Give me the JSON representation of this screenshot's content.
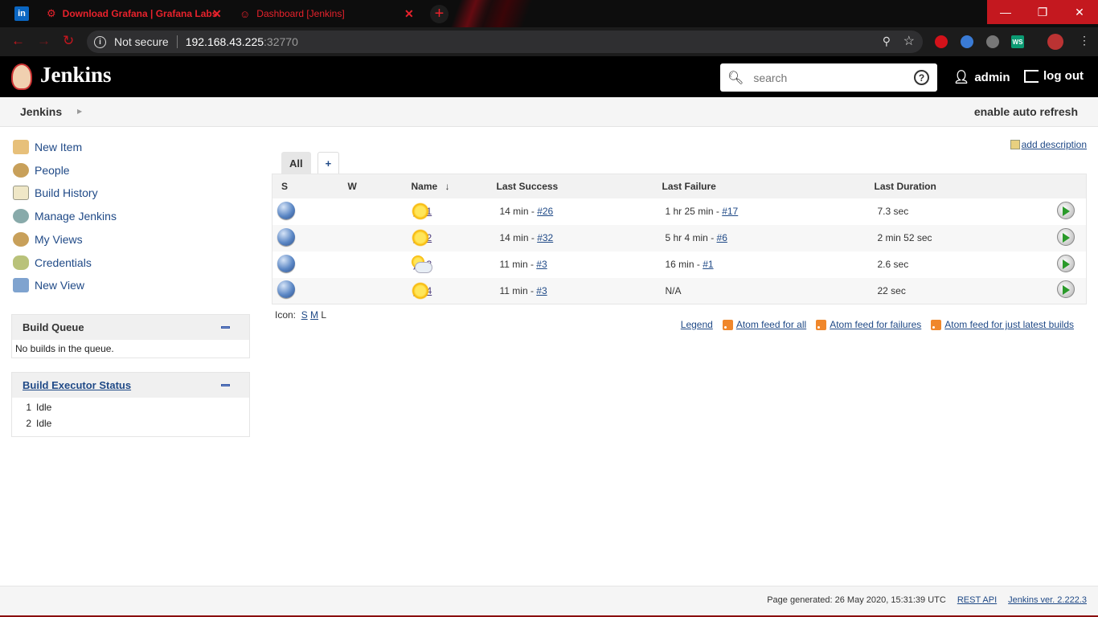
{
  "browser": {
    "tabs": [
      {
        "title": "Download Grafana | Grafana Labs",
        "active": false
      },
      {
        "title": "Dashboard [Jenkins]",
        "active": true
      }
    ],
    "security_label": "Not secure",
    "url_host": "192.168.43.225",
    "url_port": ":32770",
    "window_controls": {
      "minimize": "—",
      "restore": "❐",
      "close": "✕"
    },
    "ext_ws_label": "WS"
  },
  "header": {
    "title": "Jenkins",
    "search_placeholder": "search",
    "user": "admin",
    "logout": "log out"
  },
  "breadcrumb": {
    "root": "Jenkins",
    "auto_refresh": "enable auto refresh"
  },
  "sidebar": {
    "tasks": [
      {
        "label": "New Item",
        "icon": "new-item-icon"
      },
      {
        "label": "People",
        "icon": "people-icon"
      },
      {
        "label": "Build History",
        "icon": "build-history-icon"
      },
      {
        "label": "Manage Jenkins",
        "icon": "gear-icon"
      },
      {
        "label": "My Views",
        "icon": "people-icon"
      },
      {
        "label": "Credentials",
        "icon": "credentials-icon"
      },
      {
        "label": "New View",
        "icon": "folder-icon"
      }
    ],
    "build_queue": {
      "title": "Build Queue",
      "empty": "No builds in the queue."
    },
    "executors": {
      "title": "Build Executor Status",
      "rows": [
        {
          "num": "1",
          "status": "Idle"
        },
        {
          "num": "2",
          "status": "Idle"
        }
      ]
    }
  },
  "main": {
    "add_description": "add description",
    "view_tabs": {
      "all": "All",
      "plus": "+"
    },
    "columns": {
      "s": "S",
      "w": "W",
      "name": "Name",
      "sort_arrow": "↓",
      "last_success": "Last Success",
      "last_failure": "Last Failure",
      "last_duration": "Last Duration"
    },
    "jobs": [
      {
        "name": "job1",
        "weather": "sunny",
        "success_time": "14 min - ",
        "success_build": "#26",
        "failure_time": "1 hr 25 min - ",
        "failure_build": "#17",
        "duration": "7.3 sec"
      },
      {
        "name": "job2",
        "weather": "sunny",
        "success_time": "14 min - ",
        "success_build": "#32",
        "failure_time": "5 hr 4 min - ",
        "failure_build": "#6",
        "duration": "2 min 52 sec"
      },
      {
        "name": "job3",
        "weather": "partly-cloudy",
        "success_time": "11 min - ",
        "success_build": "#3",
        "failure_time": "16 min - ",
        "failure_build": "#1",
        "duration": "2.6 sec"
      },
      {
        "name": "job4",
        "weather": "sunny",
        "success_time": "11 min - ",
        "success_build": "#3",
        "failure_time": "N/A",
        "failure_build": "",
        "duration": "22 sec"
      }
    ],
    "icon_size": {
      "label": "Icon:",
      "s": "S",
      "m": "M",
      "l": "L"
    },
    "feeds": {
      "legend": "Legend",
      "all": "Atom feed for all",
      "failures": "Atom feed for failures",
      "latest": "Atom feed for just latest builds"
    }
  },
  "footer": {
    "generated": "Page generated: 26 May 2020, 15:31:39 UTC",
    "rest_api": "REST API",
    "version": "Jenkins ver. 2.222.3"
  }
}
